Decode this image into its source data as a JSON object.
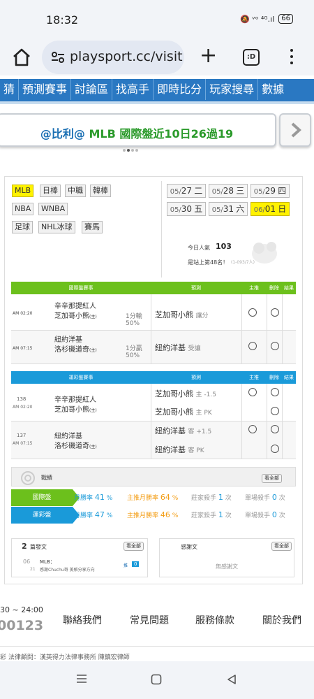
{
  "status": {
    "time": "18:32",
    "icons": "🔕 ᵛᵒ ⁴ᴳ.ıl",
    "battery": "66"
  },
  "browser": {
    "url": "playsport.cc/visit",
    "tabs_label": ":D"
  },
  "nav": {
    "items": [
      "猜",
      "預測賽事",
      "討論區",
      "找高手",
      "即時比分",
      "玩家搜尋",
      "數據"
    ]
  },
  "banner": {
    "prefix": "@比利@",
    "rest": " MLB 國際盤近10日26過19"
  },
  "leagues": [
    "MLB",
    "日棒",
    "中職",
    "韓棒",
    "NBA",
    "WNBA",
    "足球",
    "NHL冰球",
    "賽馬"
  ],
  "dates": [
    {
      "md": "05/",
      "d": "27",
      "w": "二"
    },
    {
      "md": "05/",
      "d": "28",
      "w": "三"
    },
    {
      "md": "05/",
      "d": "29",
      "w": "四"
    },
    {
      "md": "05/",
      "d": "30",
      "w": "五"
    },
    {
      "md": "05/",
      "d": "31",
      "w": "六"
    },
    {
      "md": "06/",
      "d": "01",
      "w": "日"
    }
  ],
  "popularity": {
    "label": "今日人氣",
    "value": "103",
    "rank": "是站上第48名！",
    "rank_sub": "(1-093/7人)"
  },
  "intl": {
    "headers": [
      "國際盤賽事",
      "預測",
      "主推",
      "刪除",
      "結果"
    ],
    "rows": [
      {
        "time": "AM 02:20",
        "team1": "辛辛那提紅人",
        "team2": "芝加哥小熊",
        "tag": "(主)",
        "line1": "1分輸",
        "line2": "50%",
        "pick": "芝加哥小熊",
        "pick_type": "讓分"
      },
      {
        "time": "AM 07:15",
        "team1": "紐約洋基",
        "team2": "洛杉磯道奇",
        "tag": "(主)",
        "line1": "1分贏",
        "line2": "50%",
        "pick": "紐約洋基",
        "pick_type": "受讓"
      }
    ]
  },
  "lottery": {
    "headers": [
      "運彩盤賽事",
      "預測",
      "主推",
      "刪除",
      "結果"
    ],
    "rows": [
      {
        "num": "138",
        "time": "AM 02:20",
        "team1": "辛辛那提紅人",
        "team2": "芝加哥小熊",
        "tag": "(主)",
        "p1": "芝加哥小熊",
        "p1t": "主 -1.5",
        "p2": "芝加哥小熊",
        "p2t": "主 PK"
      },
      {
        "num": "137",
        "time": "AM 07:15",
        "team1": "紐約洋基",
        "team2": "洛杉磯道奇",
        "tag": "(主)",
        "p1": "紐約洋基",
        "p1t": "客 +1.5",
        "p2": "紐約洋基",
        "p2t": "客 PK"
      }
    ]
  },
  "record": {
    "title": "戰績",
    "view_all": "看全部",
    "rows": [
      {
        "name": "國際盤",
        "month": "月勝率",
        "month_v": "41",
        "main": "主推月勝率",
        "main_v": "64",
        "kill": "莊家殺手",
        "kill_v": "1",
        "kill_u": "次",
        "single": "單場殺手",
        "single_v": "0",
        "single_u": "次",
        "pct": "%"
      },
      {
        "name": "運彩盤",
        "month": "月勝率",
        "month_v": "47",
        "main": "主推月勝率",
        "main_v": "46",
        "kill": "莊家殺手",
        "kill_v": "1",
        "kill_u": "次",
        "single": "單場殺手",
        "single_v": "0",
        "single_u": "次",
        "pct": "%"
      }
    ]
  },
  "posts": {
    "count": "2",
    "title": "篇發文",
    "view_all": "看全部",
    "date": "06",
    "date2": "21",
    "league": "MLB：",
    "text": "感謝Chuchu哥 美帳分享方向",
    "tag": "推",
    "num": "0"
  },
  "thanks": {
    "title": "感謝文",
    "view_all": "看全部",
    "empty": "無感謝文"
  },
  "footer": {
    "hours": "30 ~ 24:00",
    "phone": "00123",
    "links": [
      "聯絡我們",
      "常見問題",
      "服務條款",
      "關於我們"
    ],
    "legal": "彩 法律顧問：漢英得力法律事務所 陳鎮宏律師"
  },
  "colors": {
    "nav": "#2a78c2",
    "intl": "#6cc01c",
    "lottery": "#1a9ad9",
    "banner_green": "#2a9a2a",
    "highlight": "#fff200"
  }
}
